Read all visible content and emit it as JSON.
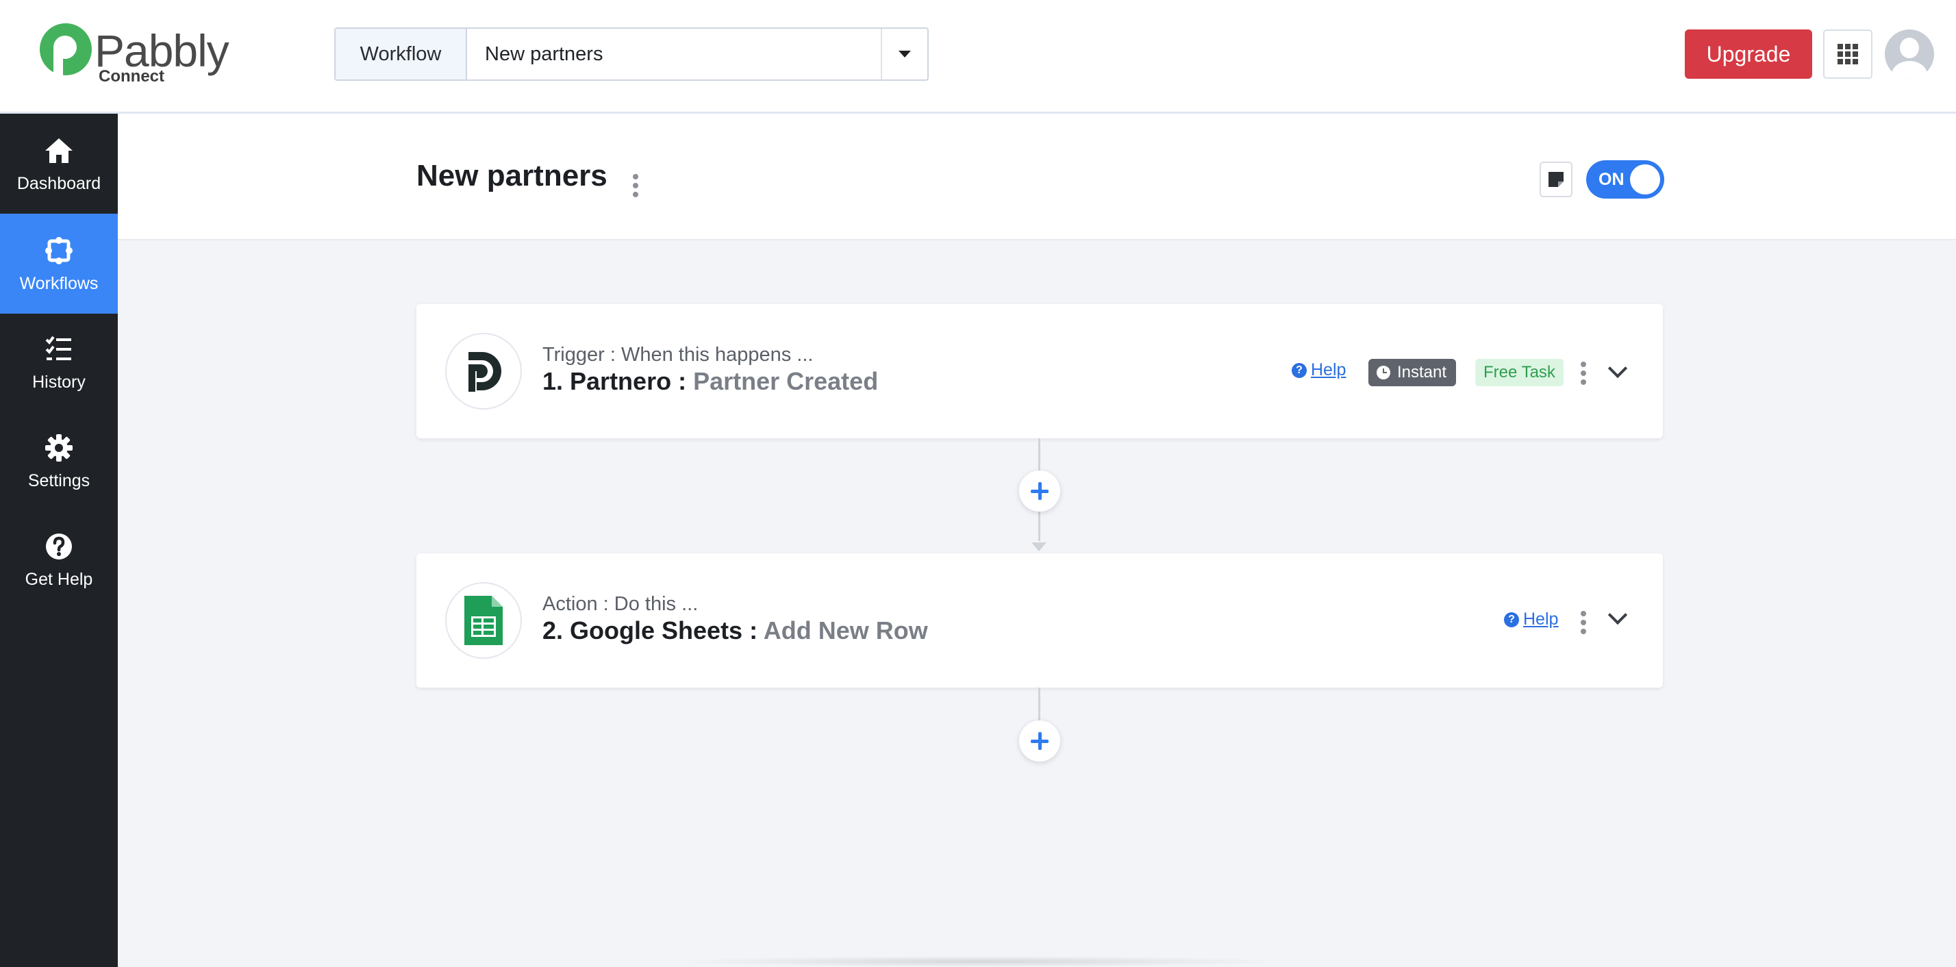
{
  "brand": {
    "name": "Pabbly",
    "product": "Connect",
    "color": "#44b25c"
  },
  "header": {
    "workflow_label": "Workflow",
    "workflow_selected": "New partners",
    "upgrade_label": "Upgrade",
    "apps_icon": "grid-icon",
    "avatar_icon": "user-avatar-icon"
  },
  "sidebar": {
    "items": [
      {
        "label": "Dashboard",
        "icon": "home-icon",
        "active": false
      },
      {
        "label": "Workflows",
        "icon": "workflow-icon",
        "active": true
      },
      {
        "label": "History",
        "icon": "list-check-icon",
        "active": false
      },
      {
        "label": "Settings",
        "icon": "gear-icon",
        "active": false
      },
      {
        "label": "Get Help",
        "icon": "question-circle-icon",
        "active": false
      }
    ]
  },
  "workflow": {
    "title": "New partners",
    "toggle_label": "ON",
    "toggle_on": true
  },
  "steps": [
    {
      "kind": "Trigger : When this happens ...",
      "number_app": "1. Partnero :",
      "event": "Partner Created",
      "app_icon": "partnero-logo-icon",
      "help_label": "Help",
      "badge_instant": "Instant",
      "badge_free": "Free Task"
    },
    {
      "kind": "Action : Do this ...",
      "number_app": "2. Google Sheets :",
      "event": "Add New Row",
      "app_icon": "google-sheets-icon",
      "help_label": "Help"
    }
  ],
  "colors": {
    "accent": "#3a86f7",
    "upgrade": "#d63a44",
    "sidebar": "#1f2327"
  }
}
